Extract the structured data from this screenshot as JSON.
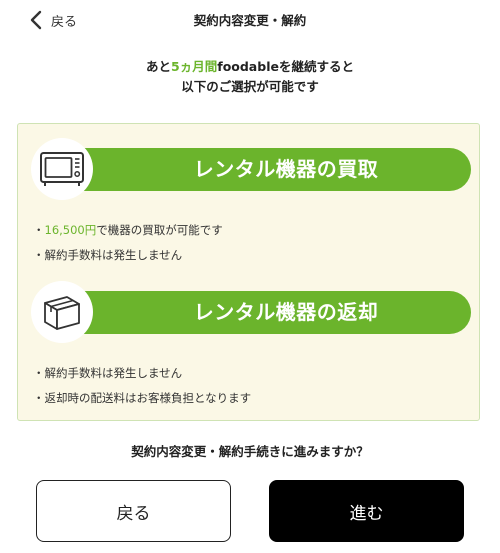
{
  "header": {
    "back_label": "戻る",
    "title": "契約内容変更・解約"
  },
  "intro": {
    "prefix": "あと",
    "months": "5ヵ月間",
    "suffix": "foodableを継続すると",
    "line2": "以下のご選択が可能です"
  },
  "options": [
    {
      "icon": "microwave-icon",
      "title": "レンタル機器の買取",
      "bullets": {
        "price": "16,500円",
        "price_text": "で機器の買取が可能です",
        "fee": "解約手数料は発生しません"
      }
    },
    {
      "icon": "box-icon",
      "title": "レンタル機器の返却",
      "bullets": {
        "fee": "解約手数料は発生しません",
        "shipping": "返却時の配送料はお客様負担となります"
      }
    }
  ],
  "bullet_mark": "・",
  "question": "契約内容変更・解約手続きに進みますか？",
  "buttons": {
    "back": "戻る",
    "next": "進む"
  },
  "colors": {
    "accent": "#6cb52d",
    "banner": "#6bb42c",
    "panel_bg": "#fbf8e6",
    "panel_border": "#cfe3b4",
    "primary_button": "#000000"
  }
}
